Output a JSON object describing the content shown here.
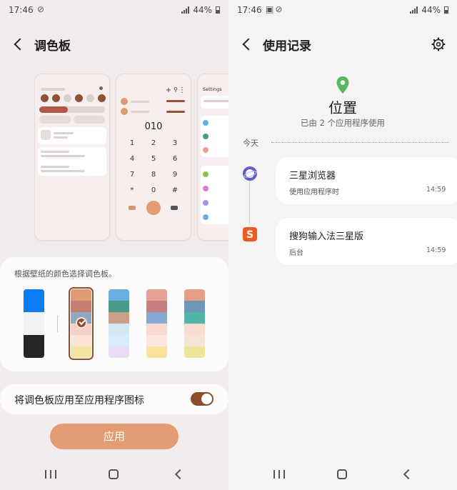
{
  "left": {
    "status": {
      "time": "17:46",
      "battery": "44%"
    },
    "header": {
      "title": "调色板"
    },
    "preview_dialer": {
      "number": "010",
      "keys": [
        "1",
        "2",
        "3",
        "4",
        "5",
        "6",
        "7",
        "8",
        "9",
        "*",
        "0",
        "#"
      ]
    },
    "preview_settings": {
      "title": "Settings"
    },
    "palette_hint": "根据壁纸的颜色选择调色板。",
    "palettes": [
      {
        "colors": [
          "#0a7cf5",
          "#f2f2f2",
          "#252525"
        ],
        "selected": false
      },
      {
        "colors": [
          "#e09a72",
          "#c47e73",
          "#8ea9c0",
          "#f4d3c6",
          "#fce3d8",
          "#f2e4a3"
        ],
        "selected": true
      },
      {
        "colors": [
          "#6aaee0",
          "#4a9a8c",
          "#c9a089",
          "#d3e7f4",
          "#d9ecfb",
          "#e8dcf7"
        ],
        "selected": false
      },
      {
        "colors": [
          "#e8a097",
          "#c97e80",
          "#86a9d2",
          "#fbd9d2",
          "#fce6e0",
          "#f7e39a"
        ],
        "selected": false
      },
      {
        "colors": [
          "#e3a085",
          "#6f96b5",
          "#53b5a7",
          "#f7dcd0",
          "#f6e4d7",
          "#eee49a"
        ],
        "selected": false
      }
    ],
    "toggle_label": "将调色板应用至应用程序图标",
    "apply_label": "应用"
  },
  "right": {
    "status": {
      "time": "17:46",
      "battery": "44%"
    },
    "header": {
      "title": "使用记录"
    },
    "location_title": "位置",
    "location_sub": "已由 2 个应用程序使用",
    "today_label": "今天",
    "entries": [
      {
        "name": "三星浏览器",
        "desc": "使用应用程序时",
        "time": "14:59"
      },
      {
        "name": "搜狗输入法三星版",
        "desc": "后台",
        "time": "14:59"
      }
    ]
  },
  "colors": {
    "accent": "#8d4d2b",
    "apply_button": "#e39c73",
    "pin": "#5bb85d"
  }
}
